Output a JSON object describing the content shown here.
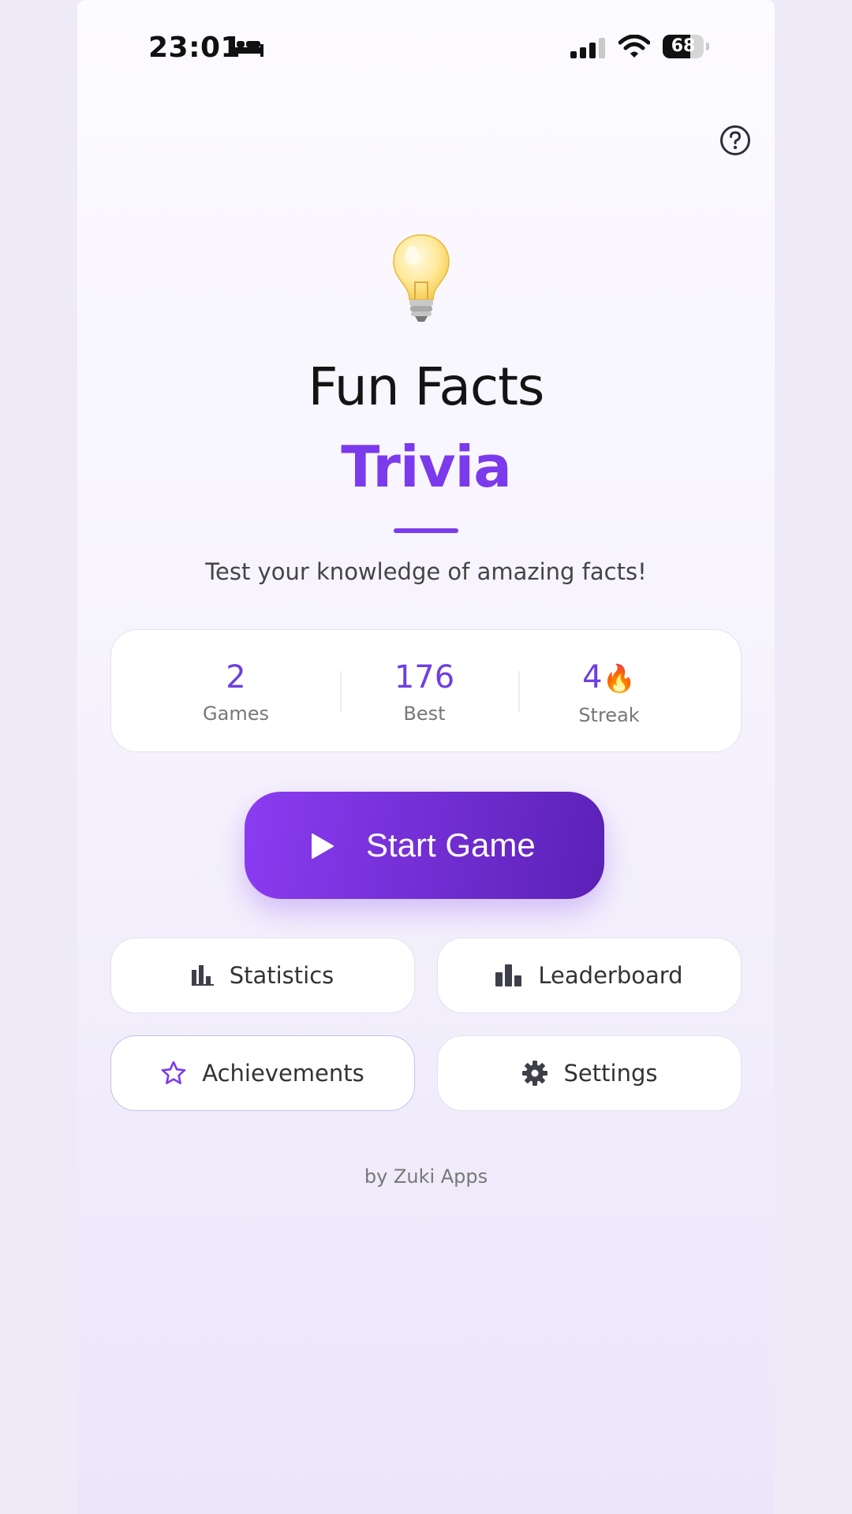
{
  "status_bar": {
    "time": "23:01",
    "battery_level": "68",
    "battery_fraction": 0.68
  },
  "header": {
    "help_icon": "question-circle-icon"
  },
  "hero": {
    "icon": "light-bulb-icon",
    "title": "Fun Facts",
    "subtitle": "Trivia",
    "tagline": "Test your knowledge of amazing facts!"
  },
  "stats": [
    {
      "value": "2",
      "label": "Games"
    },
    {
      "value": "176",
      "label": "Best"
    },
    {
      "value": "4",
      "suffix": "🔥",
      "label": "Streak"
    }
  ],
  "start_button": {
    "label": "Start Game",
    "icon": "play-icon"
  },
  "menu": {
    "statistics": {
      "label": "Statistics",
      "icon": "bar-chart-icon"
    },
    "leaderboard": {
      "label": "Leaderboard",
      "icon": "leaderboard-icon"
    },
    "achievements": {
      "label": "Achievements",
      "icon": "star-outline-icon"
    },
    "settings": {
      "label": "Settings",
      "icon": "gear-icon"
    }
  },
  "footer": {
    "credit": "by Zuki Apps"
  },
  "colors": {
    "accent": "#7c3aed",
    "accent_dark": "#5b21b6",
    "title": "#141414",
    "muted": "#777777",
    "background": "#f6f3fd"
  }
}
